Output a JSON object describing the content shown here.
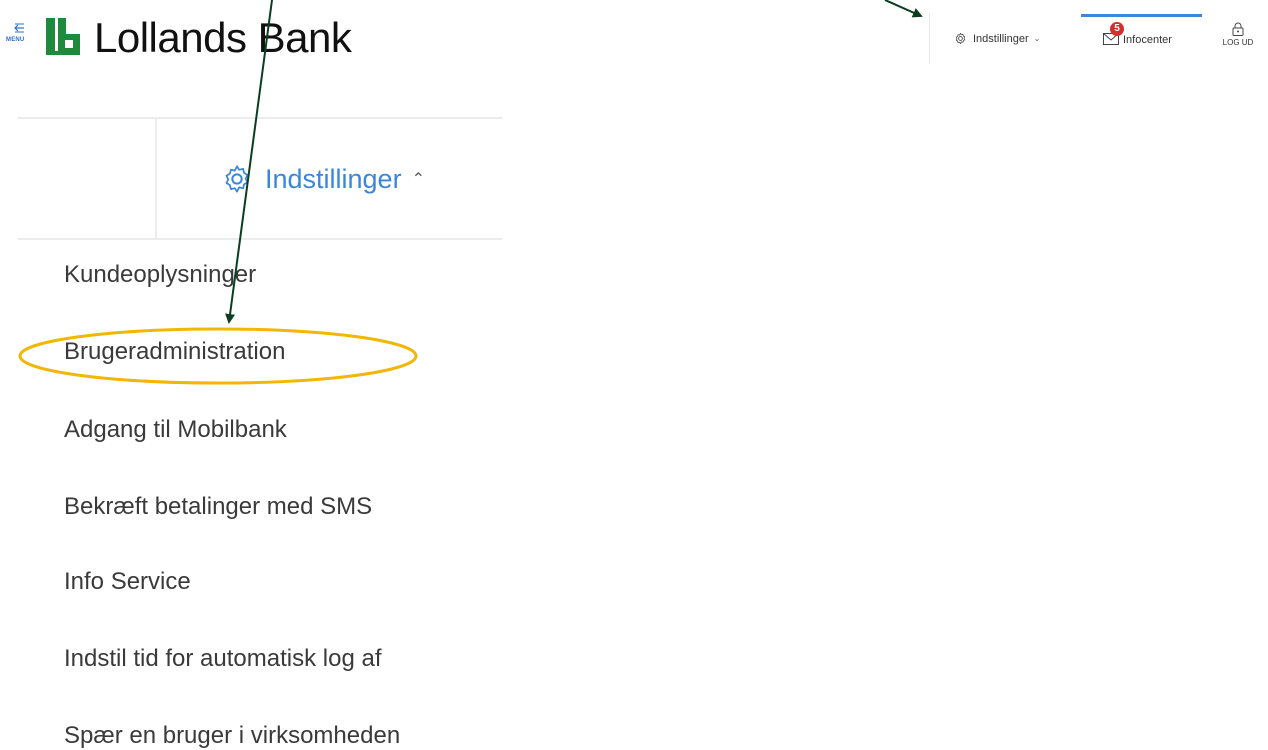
{
  "header": {
    "menu_label": "MENU",
    "logo_text": "Lollands Bank",
    "settings_label": "Indstillinger",
    "infocenter_label": "Infocenter",
    "infocenter_badge": "5",
    "logout_label": "LOG UD"
  },
  "dropdown": {
    "title": "Indstillinger",
    "items": [
      "Kundeoplysninger",
      "Brugeradministration",
      "Adgang til Mobilbank",
      "Bekræft betalinger med SMS",
      "Info Service",
      "Indstil tid for automatisk log af",
      "Spær en bruger i virksomheden"
    ]
  },
  "colors": {
    "brand_green": "#1f8a3b",
    "accent_blue": "#3a86db",
    "badge_red": "#d32f2f",
    "highlight_yellow": "#f2b705",
    "arrow_green": "#0b3d1f"
  },
  "icons": {
    "menu": "arrow-left-icon",
    "settings": "gear-icon",
    "infocenter": "envelope-icon",
    "logout": "lock-icon"
  }
}
